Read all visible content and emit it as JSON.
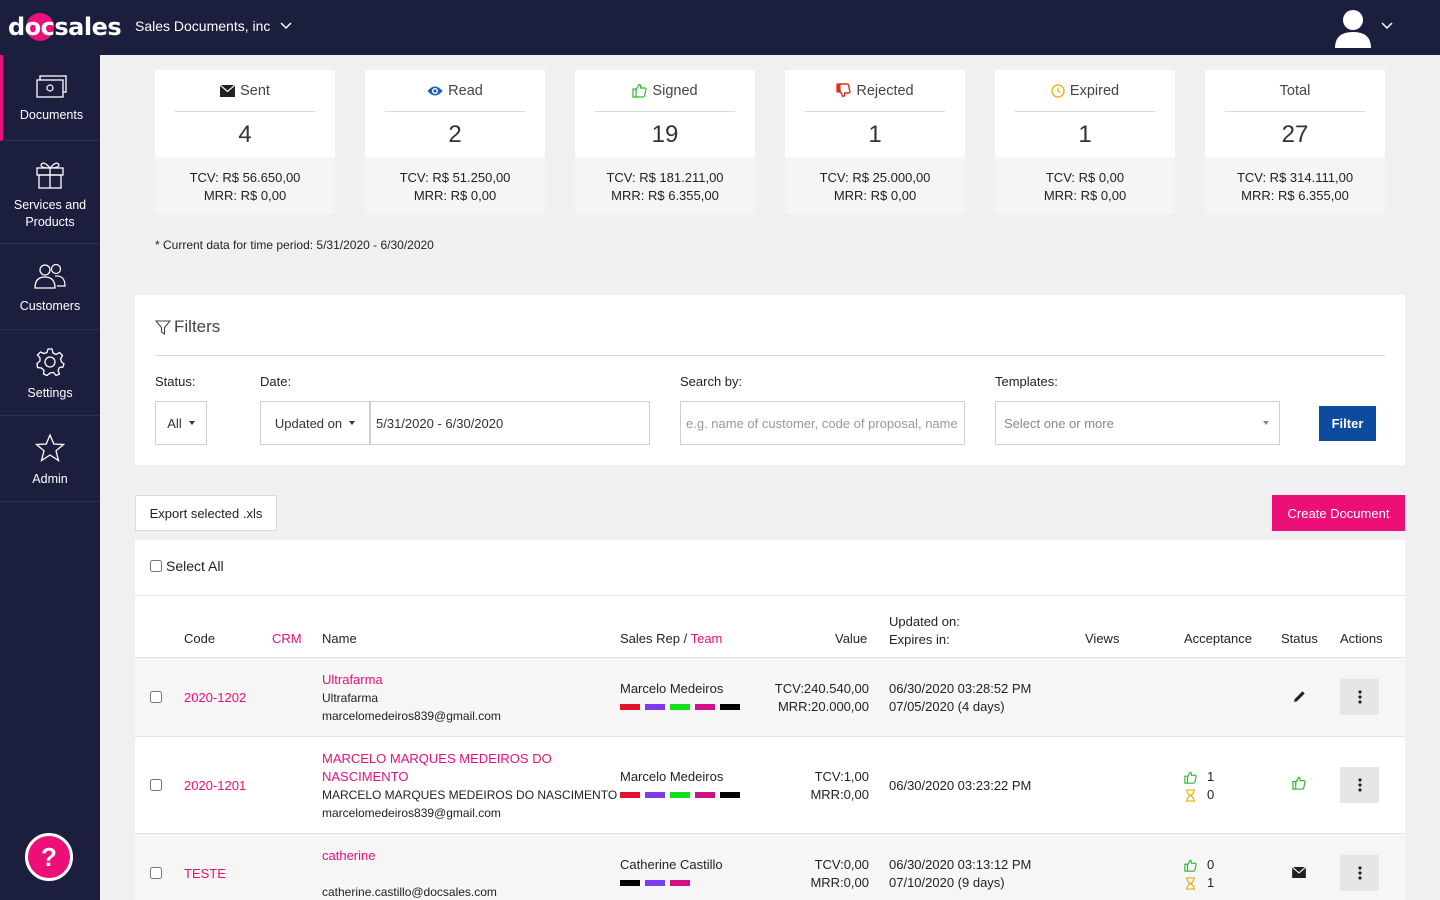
{
  "app": {
    "logo_text": "docsales",
    "org_name": "Sales Documents, inc",
    "colors": {
      "navy": "#1c1e3e",
      "accent": "#ec0f78",
      "primary": "#0d4ba0"
    }
  },
  "sidebar": {
    "items": [
      {
        "label": "Documents",
        "icon": "documents-icon"
      },
      {
        "label": "Services and Products",
        "icon": "gift-icon"
      },
      {
        "label": "Customers",
        "icon": "users-icon"
      },
      {
        "label": "Settings",
        "icon": "gear-icon"
      },
      {
        "label": "Admin",
        "icon": "star-icon"
      }
    ],
    "help_label": "?"
  },
  "stats": [
    {
      "label": "Sent",
      "icon": "envelope-icon",
      "count": "4",
      "tcv": "TCV: R$ 56.650,00",
      "mrr": "MRR: R$ 0,00"
    },
    {
      "label": "Read",
      "icon": "eye-icon",
      "count": "2",
      "tcv": "TCV: R$ 51.250,00",
      "mrr": "MRR: R$ 0,00"
    },
    {
      "label": "Signed",
      "icon": "thumbs-up-icon",
      "count": "19",
      "tcv": "TCV: R$ 181.211,00",
      "mrr": "MRR: R$ 6.355,00"
    },
    {
      "label": "Rejected",
      "icon": "thumbs-down-icon",
      "count": "1",
      "tcv": "TCV: R$ 25.000,00",
      "mrr": "MRR: R$ 0,00"
    },
    {
      "label": "Expired",
      "icon": "clock-icon",
      "count": "1",
      "tcv": "TCV: R$ 0,00",
      "mrr": "MRR: R$ 0,00"
    },
    {
      "label": "Total",
      "icon": "",
      "count": "27",
      "tcv": "TCV: R$ 314.111,00",
      "mrr": "MRR: R$ 6.355,00"
    }
  ],
  "period_note": "* Current data for time period: 5/31/2020 - 6/30/2020",
  "filters": {
    "title": "Filters",
    "status_label": "Status:",
    "status_value": "All",
    "date_label": "Date:",
    "date_type": "Updated on",
    "date_range": "5/31/2020 - 6/30/2020",
    "search_label": "Search by:",
    "search_placeholder": "e.g. name of customer, code of proposal, name",
    "templates_label": "Templates:",
    "templates_placeholder": "Select one or more",
    "filter_button": "Filter"
  },
  "actions": {
    "export_label": "Export selected .xls",
    "create_label": "Create Document"
  },
  "table": {
    "select_all": "Select All",
    "headers": {
      "code": "Code",
      "crm": "CRM",
      "name": "Name",
      "sales_rep": "Sales Rep",
      "slash": " / ",
      "team": "Team",
      "value": "Value",
      "updated_on": "Updated on:",
      "expires_in": "Expires in:",
      "views": "Views",
      "acceptance": "Acceptance",
      "status": "Status",
      "actions": "Actions"
    },
    "rows": [
      {
        "code": "2020-1202",
        "name": "Ultrafarma",
        "company": "Ultrafarma",
        "email": "marcelomedeiros839@gmail.com",
        "sales_rep": "Marcelo Medeiros",
        "team_colors": [
          "#e8112d",
          "#7b3bf0",
          "#14e01a",
          "#d10f86",
          "#000000"
        ],
        "tcv": "TCV:240.540,00",
        "mrr": "MRR:20.000,00",
        "updated": "06/30/2020 03:28:52 PM",
        "expires": "07/05/2020 (4 days)",
        "acceptance": null,
        "status_icon": "pencil-icon"
      },
      {
        "code": "2020-1201",
        "name": "MARCELO MARQUES MEDEIROS DO NASCIMENTO",
        "name_line1": "MARCELO MARQUES MEDEIROS DO",
        "name_line2": "NASCIMENTO",
        "company": "MARCELO MARQUES MEDEIROS DO NASCIMENTO",
        "email": "marcelomedeiros839@gmail.com",
        "sales_rep": "Marcelo Medeiros",
        "team_colors": [
          "#e8112d",
          "#7b3bf0",
          "#14e01a",
          "#d10f86",
          "#000000"
        ],
        "tcv": "TCV:1,00",
        "mrr": "MRR:0,00",
        "updated": "06/30/2020 03:23:22 PM",
        "expires": "",
        "acceptance": {
          "accepted": "1",
          "pending": "0"
        },
        "status_icon": "thumbs-up-icon"
      },
      {
        "code": "TESTE",
        "name": "catherine",
        "company": "",
        "email": "catherine.castillo@docsales.com",
        "sales_rep": "Catherine Castillo",
        "team_colors": [
          "#000000",
          "#7b3bf0",
          "#d10f86"
        ],
        "tcv": "TCV:0,00",
        "mrr": "MRR:0,00",
        "updated": "06/30/2020 03:13:12 PM",
        "expires": "07/10/2020 (9 days)",
        "acceptance": {
          "accepted": "0",
          "pending": "1"
        },
        "status_icon": "envelope-icon"
      }
    ]
  }
}
